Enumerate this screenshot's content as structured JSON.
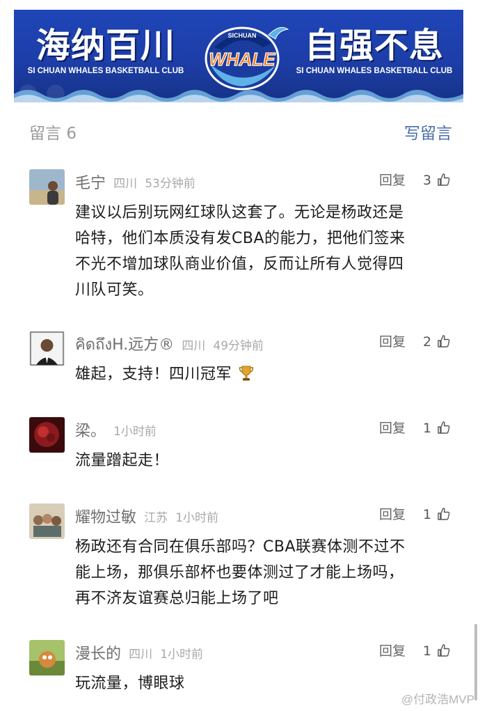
{
  "banner": {
    "left_title": "海纳百川",
    "right_title": "自强不息",
    "left_sub": "SI CHUAN WHALES BASKETBALL CLUB",
    "right_sub": "SI CHUAN WHALES BASKETBALL CLUB",
    "logo_text": "WHALE",
    "logo_top_text": "SICHUAN",
    "colors": {
      "banner_blue": "#1f45b8",
      "logo_orange": "#f07a1a"
    }
  },
  "header": {
    "count_label": "留言",
    "count": "6",
    "write_label": "写留言"
  },
  "comments": [
    {
      "name": "毛宁",
      "location": "四川",
      "time": "53分钟前",
      "reply_label": "回复",
      "likes": "3",
      "lines": [
        "建议以后别玩网红球队这套了。无论是杨政还是",
        "哈特，他们本质没有发CBA的能力，把他们签来",
        "不光不增加球队商业价值，反而让所有人觉得四",
        "川队可笑。"
      ]
    },
    {
      "name": "คิดถึงH.远方®",
      "location": "四川",
      "time": "49分钟前",
      "reply_label": "回复",
      "likes": "2",
      "lines": [
        "雄起，支持！四川冠军"
      ],
      "emoji": "trophy-icon"
    },
    {
      "name": "梁。",
      "location": "",
      "time": "1小时前",
      "reply_label": "回复",
      "likes": "1",
      "lines": [
        "流量蹭起走！"
      ]
    },
    {
      "name": "耀物过敏",
      "location": "江苏",
      "time": "1小时前",
      "reply_label": "回复",
      "likes": "1",
      "lines": [
        "杨政还有合同在俱乐部吗？CBA联赛体测不过不",
        "能上场，那俱乐部杯也要体测过了才能上场吗，",
        "再不济友谊赛总归能上场了吧"
      ]
    },
    {
      "name": "漫长的",
      "location": "四川",
      "time": "1小时前",
      "reply_label": "回复",
      "likes": "1",
      "lines": [
        "玩流量，博眼球"
      ]
    }
  ],
  "watermark": "@付政浩MVP"
}
